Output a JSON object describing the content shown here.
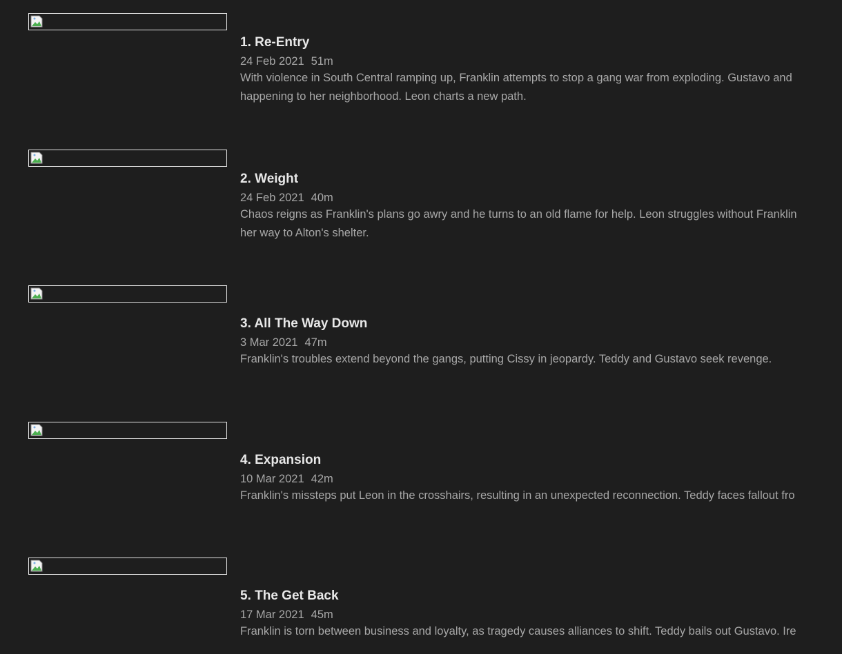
{
  "episodes": [
    {
      "title": "1. Re-Entry",
      "date": "24 Feb 2021",
      "runtime": "51m",
      "description_lines": [
        "With violence in South Central ramping up, Franklin attempts to stop a gang war from exploding. Gustavo and",
        "happening to her neighborhood. Leon charts a new path."
      ]
    },
    {
      "title": "2. Weight",
      "date": "24 Feb 2021",
      "runtime": "40m",
      "description_lines": [
        "Chaos reigns as Franklin's plans go awry and he turns to an old flame for help. Leon struggles without Franklin",
        "her way to Alton's shelter."
      ]
    },
    {
      "title": "3. All The Way Down",
      "date": "3 Mar 2021",
      "runtime": "47m",
      "description_lines": [
        "Franklin's troubles extend beyond the gangs, putting Cissy in jeopardy. Teddy and Gustavo seek revenge."
      ]
    },
    {
      "title": "4. Expansion",
      "date": "10 Mar 2021",
      "runtime": "42m",
      "description_lines": [
        "Franklin's missteps put Leon in the crosshairs, resulting in an unexpected reconnection. Teddy faces fallout fro"
      ]
    },
    {
      "title": "5. The Get Back",
      "date": "17 Mar 2021",
      "runtime": "45m",
      "description_lines": [
        "Franklin is torn between business and loyalty, as tragedy causes alliances to shift. Teddy bails out Gustavo. Ire"
      ]
    }
  ]
}
